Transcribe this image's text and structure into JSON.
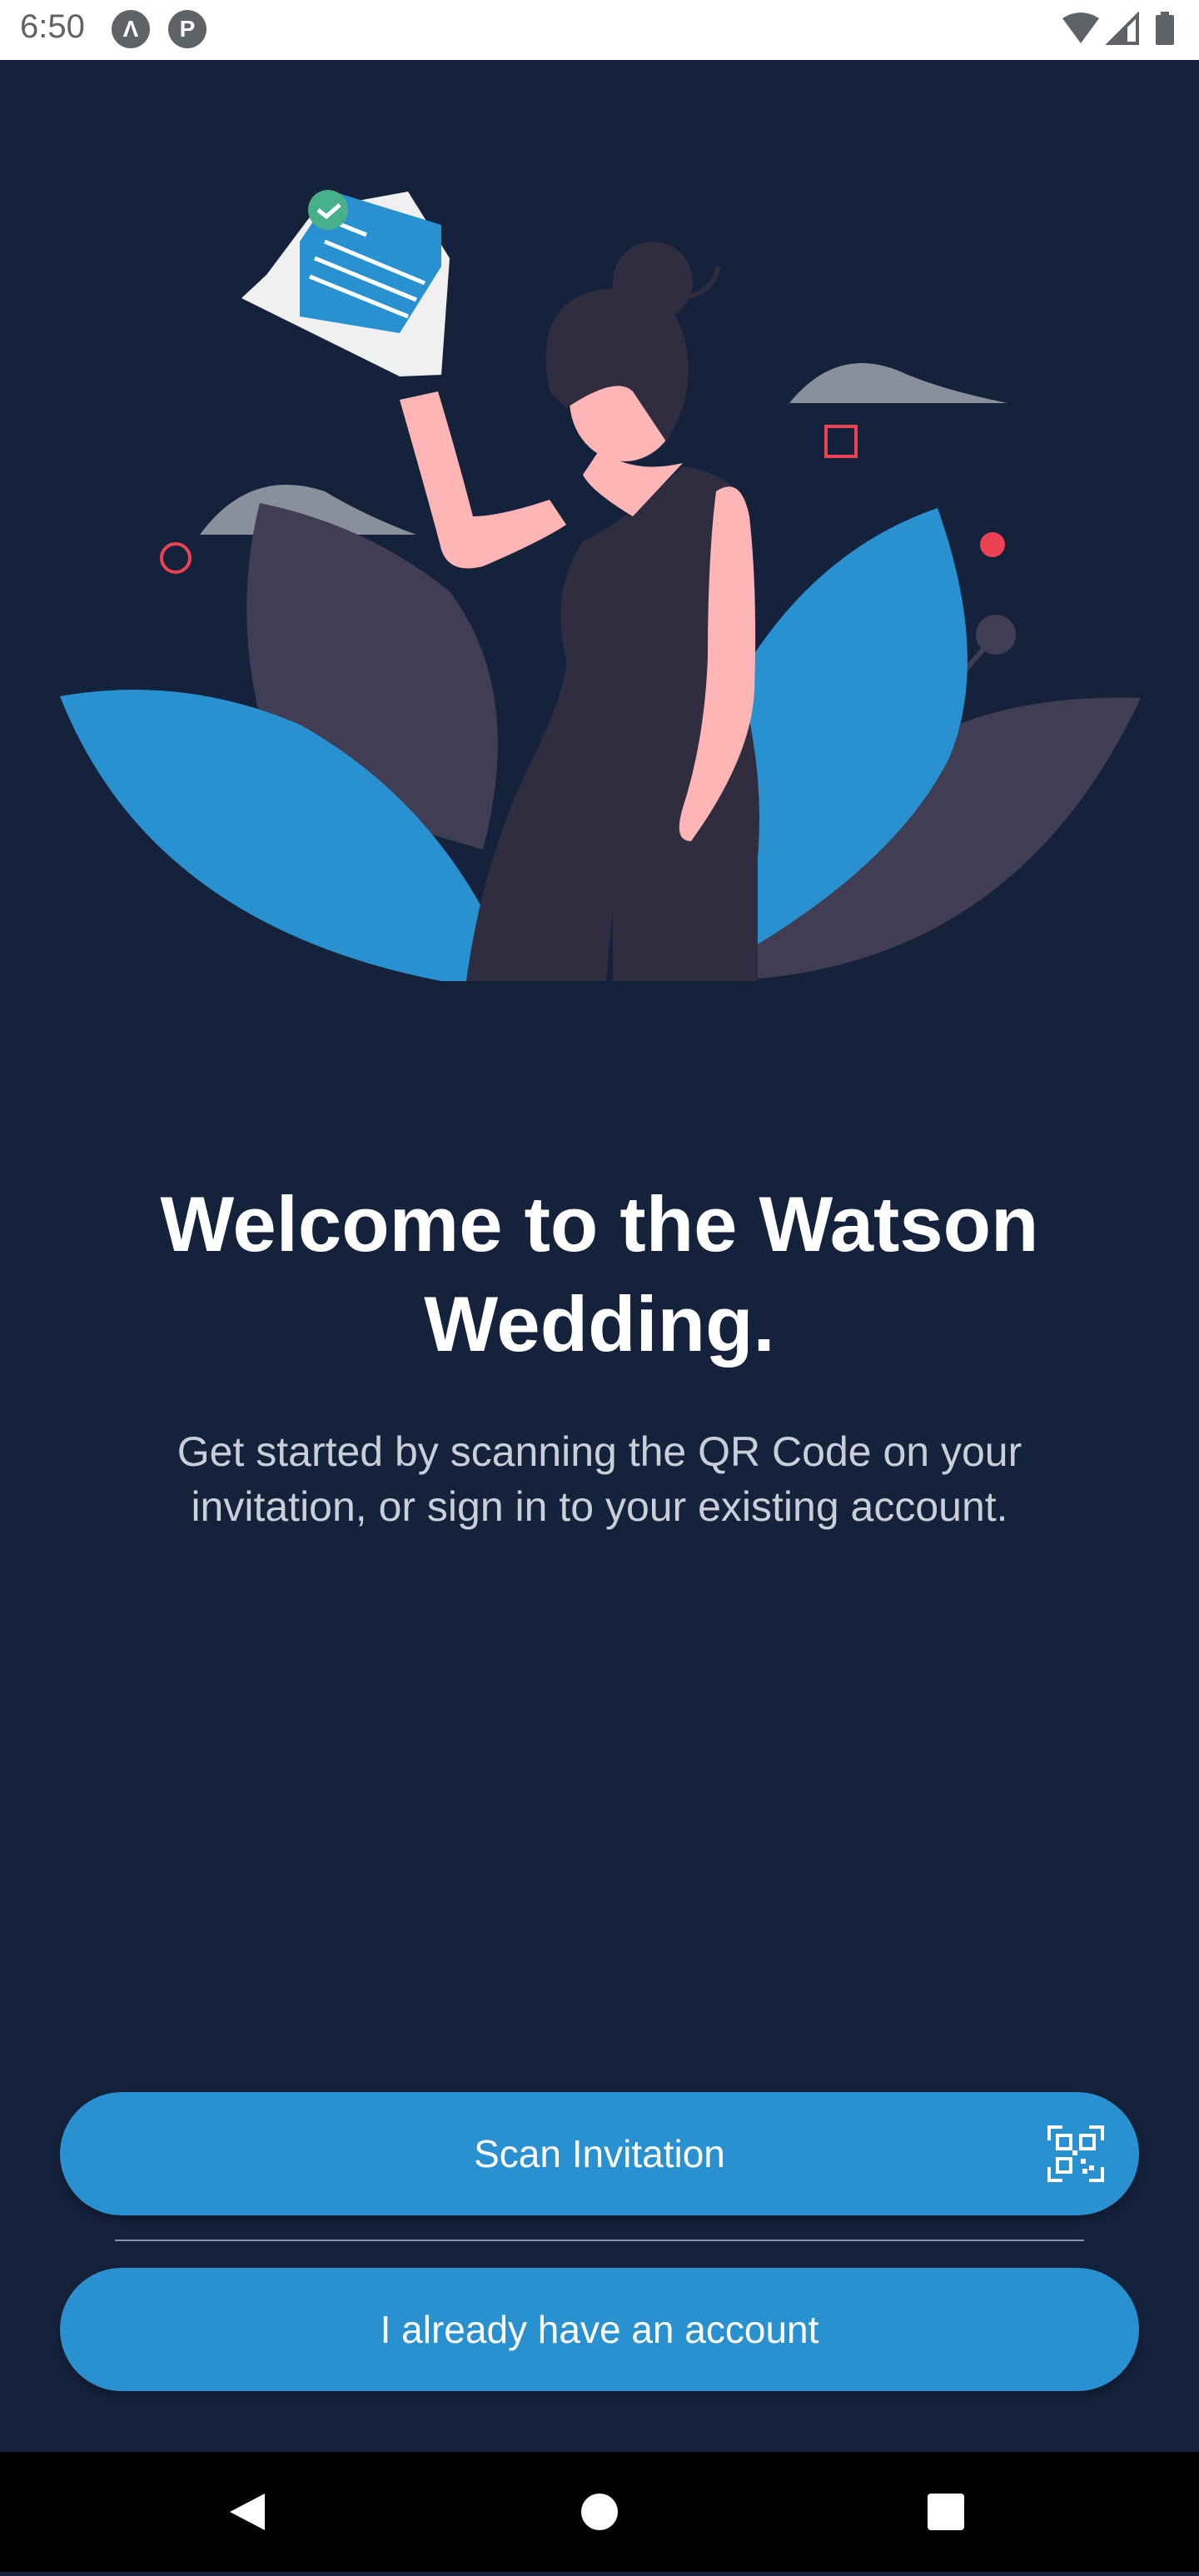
{
  "status_bar": {
    "time": "6:50",
    "icons": [
      "app-icon-a",
      "app-icon-p",
      "wifi-icon",
      "signal-icon",
      "battery-icon"
    ]
  },
  "welcome": {
    "title": "Welcome to the Watson Wedding.",
    "subtitle": "Get started by scanning the QR Code on your invitation, or sign in to your existing account."
  },
  "buttons": {
    "scan_label": "Scan Invitation",
    "account_label": "I already have an account"
  },
  "colors": {
    "background": "#15223c",
    "accent_blue": "#2991cf",
    "leaf_purple": "#403d55",
    "dress_dark": "#2f2d3f",
    "skin": "#fdb5b5",
    "accent_red": "#ec4254"
  },
  "nav_bar": {
    "icons": [
      "back-icon",
      "home-icon",
      "recents-icon"
    ]
  }
}
